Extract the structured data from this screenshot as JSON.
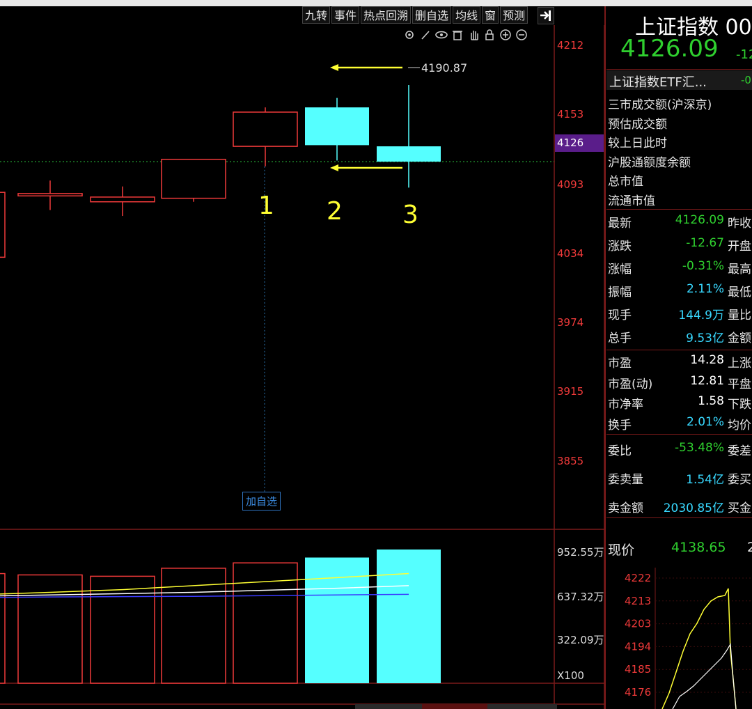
{
  "toolbar": {
    "buttons": [
      "九转",
      "事件",
      "热点回溯",
      "删自选",
      "均线",
      "窗",
      "预测"
    ]
  },
  "chart_icons": [
    "gear-icon",
    "pen-icon",
    "eye-icon",
    "trash-icon",
    "hand-icon",
    "lock-icon",
    "zoom-in-icon",
    "zoom-out-icon"
  ],
  "price_axis": [
    "4212",
    "4153",
    "4126",
    "4093",
    "4034",
    "3974",
    "3915",
    "3855"
  ],
  "current_price_tag": "4126",
  "high_annotation": "4190.87",
  "candle_labels": [
    "1",
    "2",
    "3"
  ],
  "add_watch_label": "加自选",
  "volume_axis": [
    "952.55万",
    "637.32万",
    "322.09万",
    "X100"
  ],
  "colors": {
    "up": "#f03a3a",
    "down": "#55ffff",
    "bg": "#000000",
    "ma5": "#ffff33",
    "ma10": "#ffffff",
    "ma20": "#3b3bff"
  },
  "chart_data": {
    "type": "candlestick",
    "price_ylim": [
      3815,
      4240
    ],
    "candles": [
      {
        "label": "",
        "open": 4045,
        "close": 4100,
        "high": 4100,
        "low": 4045,
        "dir": "up"
      },
      {
        "label": "",
        "open": 4099,
        "close": 4097,
        "high": 4110,
        "low": 4085,
        "dir": "up"
      },
      {
        "label": "",
        "open": 4092,
        "close": 4096,
        "high": 4105,
        "low": 4080,
        "dir": "up"
      },
      {
        "label": "",
        "open": 4095,
        "close": 4128,
        "high": 4128,
        "low": 4092,
        "dir": "up"
      },
      {
        "label": "1",
        "open": 4139,
        "close": 4168,
        "high": 4172,
        "low": 4122,
        "dir": "up"
      },
      {
        "label": "2",
        "open": 4172,
        "close": 4140,
        "high": 4180,
        "low": 4127,
        "dir": "down"
      },
      {
        "label": "3",
        "open": 4139,
        "close": 4126,
        "high": 4191,
        "low": 4104,
        "dir": "down"
      }
    ],
    "volume_ylim": [
      0,
      1000
    ],
    "volumes": [
      820,
      810,
      800,
      860,
      900,
      940,
      1000
    ],
    "ma_lines": {
      "ma5": [
        660,
        680,
        700,
        730,
        760,
        790,
        820
      ],
      "ma10": [
        650,
        660,
        670,
        680,
        695,
        710,
        730
      ],
      "ma20": [
        640,
        645,
        648,
        650,
        655,
        660,
        665
      ]
    }
  },
  "right_panel": {
    "title": "上证指数 00",
    "price": "4126.09",
    "change_short": "-12",
    "etf": "上证指数ETF汇...",
    "etf_val": "-0",
    "info_rows": [
      "三市成交额(沪深京)",
      "预估成交额",
      "较上日此时",
      "沪股通额度余额",
      "总市值",
      "流通市值"
    ],
    "quote_rows": [
      {
        "k": "最新",
        "v": "4126.09",
        "c": "green",
        "k2": "昨收"
      },
      {
        "k": "涨跌",
        "v": "-12.67",
        "c": "green",
        "k2": "开盘"
      },
      {
        "k": "涨幅",
        "v": "-0.31%",
        "c": "green",
        "k2": "最高"
      },
      {
        "k": "振幅",
        "v": "2.11%",
        "c": "cyan",
        "k2": "最低"
      },
      {
        "k": "现手",
        "v": "144.9万",
        "c": "cyan",
        "k2": "量比"
      },
      {
        "k": "总手",
        "v": "9.53亿",
        "c": "cyan",
        "k2": "金额"
      }
    ],
    "valuation_rows": [
      {
        "k": "市盈",
        "v": "14.28",
        "c": "white",
        "k2": "上涨"
      },
      {
        "k": "市盈(动)",
        "v": "12.81",
        "c": "white",
        "k2": "平盘"
      },
      {
        "k": "市净率",
        "v": "1.58",
        "c": "white",
        "k2": "下跌"
      },
      {
        "k": "换手",
        "v": "2.01%",
        "c": "cyan",
        "k2": "均价"
      }
    ],
    "order_rows": [
      {
        "k": "委比",
        "v": "-53.48%",
        "c": "green",
        "k2": "委差"
      },
      {
        "k": "委卖量",
        "v": "1.54亿",
        "c": "cyan",
        "k2": "委买"
      },
      {
        "k": "卖金额",
        "v": "2030.85亿",
        "c": "cyan",
        "k2": "买金"
      }
    ],
    "now_label": "现价",
    "now_value": "4138.65",
    "now_extra": "2",
    "mini_axis": [
      "4222",
      "4213",
      "4203",
      "4194",
      "4185",
      "4176"
    ]
  }
}
